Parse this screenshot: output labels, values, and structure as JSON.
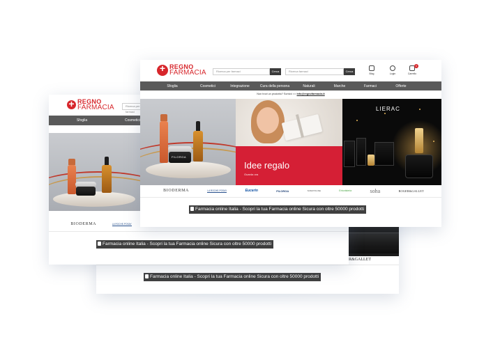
{
  "logo": {
    "line1": "REGNO",
    "line2": "FARMACIA"
  },
  "search": {
    "primary_placeholder": "Ricerca per farmaci",
    "secondary_placeholder": "Ricerca farmaci",
    "button_label": "Cerca"
  },
  "header_icons": [
    {
      "name": "blog-icon",
      "label": "Blog"
    },
    {
      "name": "user-icon",
      "label": "Login"
    },
    {
      "name": "cart-icon",
      "label": "Carrello",
      "badge": "0"
    }
  ],
  "nav": [
    "Sfoglia",
    "Cosmetici",
    "Integrazione",
    "Cura della persona",
    "Naturali",
    "Marche",
    "Farmaci",
    "Offerte"
  ],
  "nav_back": [
    "Sfoglia",
    "Cosmetici"
  ],
  "promo": {
    "text": "Non trovi un prodotto? Scrivici >> ",
    "email": "info@regnofarmacia.it"
  },
  "hero": {
    "idee_title": "Idee regalo",
    "idee_sub": "Guarda ora",
    "lierac_logo": "LIERAC",
    "filorga_label": "FILORGA"
  },
  "brands": [
    "BIODERMA",
    "LA ROCHE-POSAY",
    "Eucerin",
    "FILORGA",
    "SOMATOLINE",
    "Erboristeria",
    "soha",
    "ROGER&GALLET"
  ],
  "brands_back": [
    "BIODERMA",
    "LA ROCHE-POSAY"
  ],
  "seo_text": "Farmacia online Italia - Scopri la tua Farmacia online Sicura con oltre 50000 prodotti",
  "card_c_brand": "ROGER&GALLET",
  "colors": {
    "brand_red": "#d7262b",
    "nav_gray": "#5a5a5a",
    "idee_red": "#d51f35",
    "seo_bar": "#3f3f3f"
  }
}
